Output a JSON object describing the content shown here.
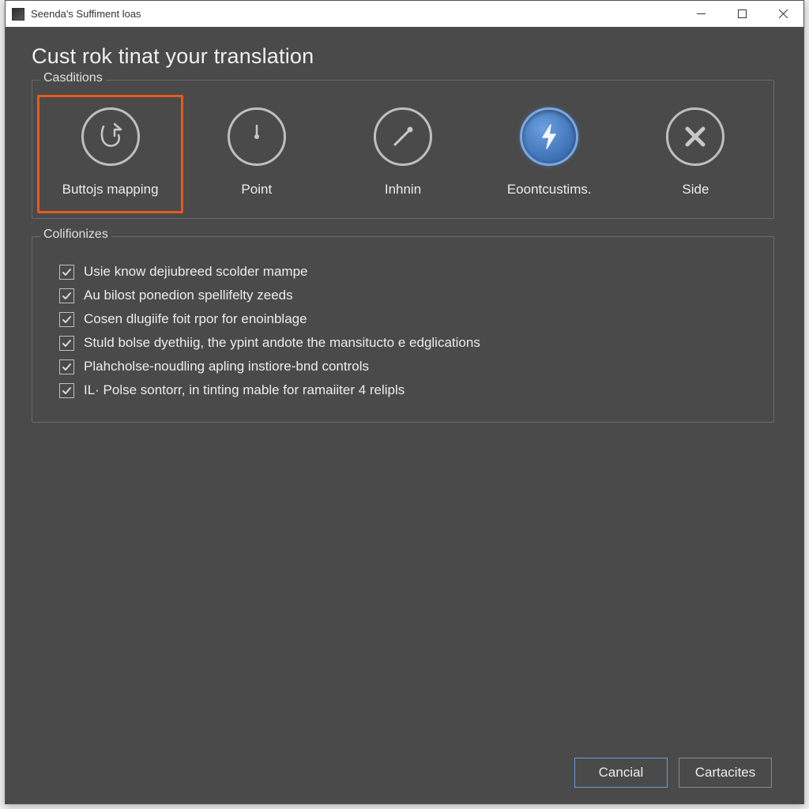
{
  "window": {
    "title": "Seenda's Suffiment loas"
  },
  "heading": "Cust rok tinat your translation",
  "categories": {
    "legend": "Casditions",
    "items": [
      {
        "label": "Buttojs mapping",
        "selected": true,
        "icon": "pointer"
      },
      {
        "label": "Point",
        "selected": false,
        "icon": "clock"
      },
      {
        "label": "Inhnin",
        "selected": false,
        "icon": "line"
      },
      {
        "label": "Eoontcustims.",
        "selected": false,
        "icon": "bolt",
        "active": true
      },
      {
        "label": "Side",
        "selected": false,
        "icon": "cross"
      }
    ]
  },
  "options": {
    "legend": "Colifionizes",
    "items": [
      {
        "checked": true,
        "label": "Usie know dejiubreed scolder mampe"
      },
      {
        "checked": true,
        "label": "Au bilost ponedion spellifelty zeeds"
      },
      {
        "checked": true,
        "label": "Cosen dlugiife foit rpor for enoinblage"
      },
      {
        "checked": true,
        "label": "Stuld bolse dyethiig, the ypint andote the mansitucto e edglications"
      },
      {
        "checked": true,
        "label": "Plahcholse-noudling apling instiore-bnd controls"
      },
      {
        "checked": true,
        "label": "IL· Polse sontorr, in tinting mable for ramaiiter 4 relipls"
      }
    ]
  },
  "footer": {
    "cancel": "Cancial",
    "confirm": "Cartacites"
  }
}
